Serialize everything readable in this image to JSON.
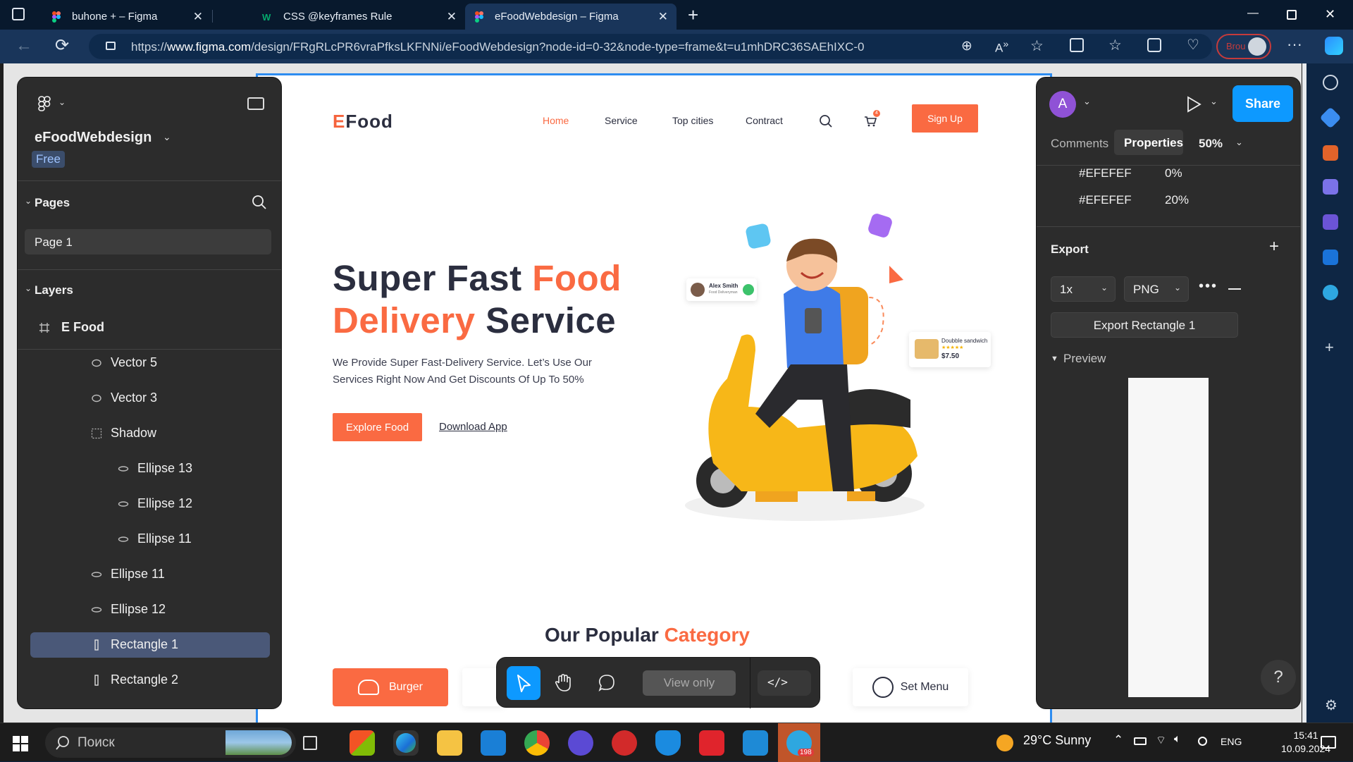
{
  "browser": {
    "tabs": [
      {
        "title": "buhone + – Figma",
        "active": false
      },
      {
        "title": "CSS @keyframes Rule",
        "active": false
      },
      {
        "title": "eFoodWebdesign – Figma",
        "active": true
      }
    ],
    "url_prefix": "https://",
    "url_domain": "www.figma.com",
    "url_path": "/design/FRgRLcPR6vraPfksLKFNNi/eFoodWebdesign?node-id=0-32&node-type=frame&t=u1mhDRC36SAEhIXC-0",
    "profile_label": "Brou"
  },
  "figma_left": {
    "file_name": "eFoodWebdesign",
    "plan_badge": "Free",
    "pages_heading": "Pages",
    "page_item": "Page 1",
    "layers_heading": "Layers",
    "layers": [
      {
        "name": "E Food",
        "icon": "frame-icon",
        "indent": 0
      },
      {
        "name": "Vector 5",
        "icon": "vector-icon",
        "indent": 1
      },
      {
        "name": "Vector 3",
        "icon": "vector-icon",
        "indent": 1
      },
      {
        "name": "Shadow",
        "icon": "group-icon",
        "indent": 1
      },
      {
        "name": "Ellipse 13",
        "icon": "ellipse-icon",
        "indent": 2
      },
      {
        "name": "Ellipse 12",
        "icon": "ellipse-icon",
        "indent": 2
      },
      {
        "name": "Ellipse 11",
        "icon": "ellipse-icon",
        "indent": 2
      },
      {
        "name": "Ellipse 11",
        "icon": "ellipse-icon",
        "indent": 1
      },
      {
        "name": "Ellipse 12",
        "icon": "ellipse-icon",
        "indent": 1
      },
      {
        "name": "Rectangle 1",
        "icon": "rectangle-icon",
        "indent": 1,
        "selected": true
      },
      {
        "name": "Rectangle 2",
        "icon": "rectangle-icon",
        "indent": 1
      }
    ]
  },
  "design": {
    "logo_e": "E",
    "logo_rest": "Food",
    "nav": [
      "Home",
      "Service",
      "Top cities",
      "Contract"
    ],
    "cart_count": "4",
    "signup": "Sign Up",
    "headline_1a": "Super Fast ",
    "headline_1b": "Food",
    "headline_2a": "Delivery",
    "headline_2b": " Service",
    "description": "We Provide Super Fast-Delivery Service. Let’s Use Our Services Right Now And Get Discounts Of Up To 50%",
    "explore": "Explore Food",
    "download": "Download App",
    "card1_name": "Alex Smith",
    "card1_sub": "Food Deliveryman",
    "card2_name": "Doubble sandwich",
    "card2_price": "$7.50",
    "popular_a": "Our Popular ",
    "popular_b": "Category",
    "categories": [
      "Burger",
      "Set Menu"
    ]
  },
  "toolbar": {
    "view_only": "View only"
  },
  "figma_right": {
    "tab_comments": "Comments",
    "tab_properties": "Properties",
    "zoom": "50%",
    "share": "Share",
    "avatar_letter": "A",
    "fills": [
      {
        "hex": "#EFEFEF",
        "opacity": "0%"
      },
      {
        "hex": "#EFEFEF",
        "opacity": "20%"
      }
    ],
    "export_heading": "Export",
    "export_scale": "1x",
    "export_format": "PNG",
    "export_button": "Export Rectangle 1",
    "preview_heading": "Preview",
    "help": "?"
  },
  "taskbar": {
    "search_placeholder": "Поиск",
    "weather": "29°C  Sunny",
    "language": "ENG",
    "time": "15:41",
    "date": "10.09.2024",
    "telegram_badge": "198"
  },
  "colors": {
    "accent": "#FA6A42",
    "figma_blue": "#0D99FF",
    "panel": "#2C2C2C"
  }
}
